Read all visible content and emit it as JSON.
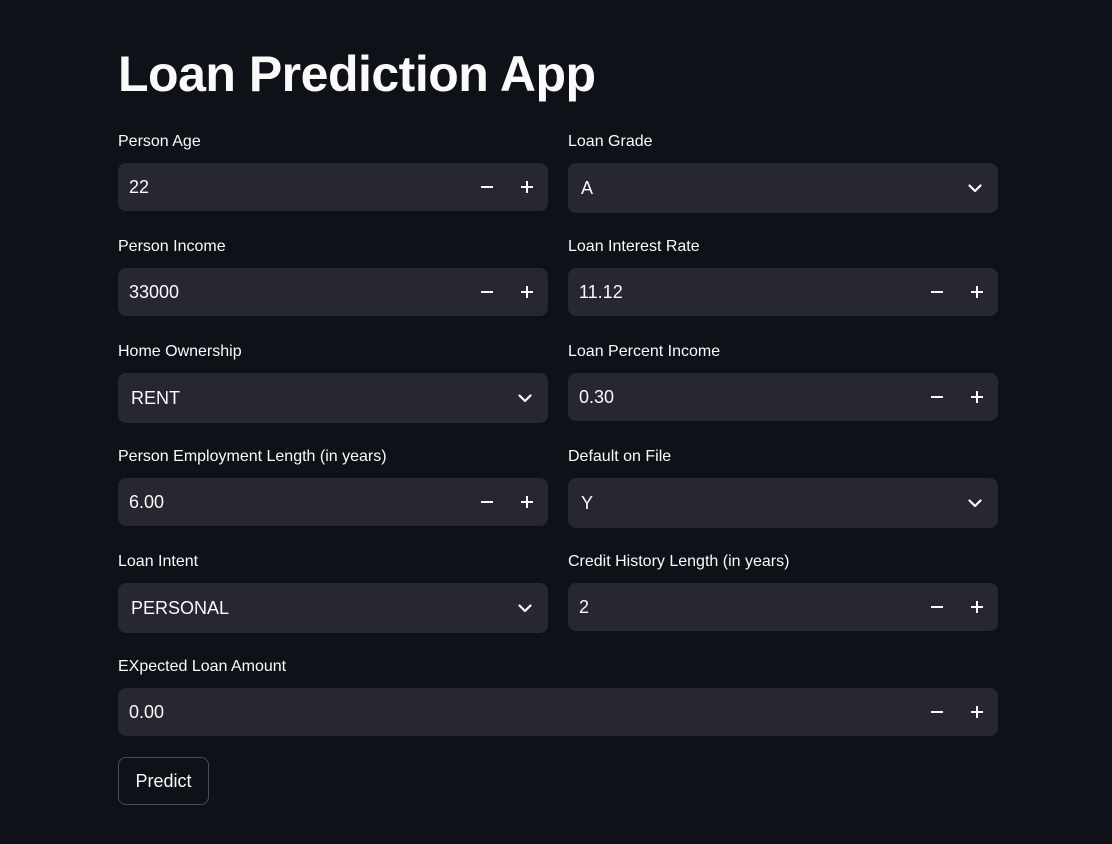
{
  "app": {
    "title": "Loan Prediction App"
  },
  "fields": {
    "person_age": {
      "label": "Person Age",
      "value": "22"
    },
    "loan_grade": {
      "label": "Loan Grade",
      "value": "A"
    },
    "person_income": {
      "label": "Person Income",
      "value": "33000"
    },
    "loan_interest_rate": {
      "label": "Loan Interest Rate",
      "value": "11.12"
    },
    "home_ownership": {
      "label": "Home Ownership",
      "value": "RENT"
    },
    "loan_percent_income": {
      "label": "Loan Percent Income",
      "value": "0.30"
    },
    "person_emp_length": {
      "label": "Person Employment Length (in years)",
      "value": "6.00"
    },
    "default_on_file": {
      "label": "Default on File",
      "value": "Y"
    },
    "loan_intent": {
      "label": "Loan Intent",
      "value": "PERSONAL"
    },
    "credit_history_length": {
      "label": "Credit History Length (in years)",
      "value": "2"
    },
    "expected_loan_amount": {
      "label": "EXpected Loan Amount",
      "value": "0.00"
    }
  },
  "actions": {
    "predict_label": "Predict"
  },
  "icons": {
    "decrement": "minus-icon",
    "increment": "plus-icon",
    "dropdown": "chevron-down-icon"
  },
  "colors": {
    "background": "#0e1117",
    "input_background": "#262730",
    "text": "#fafafa"
  }
}
